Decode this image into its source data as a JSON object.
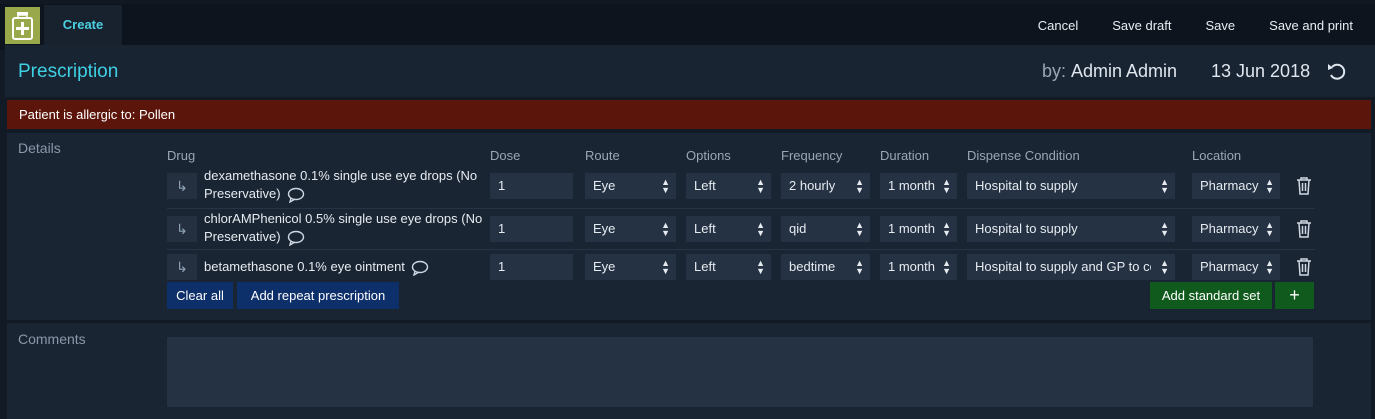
{
  "topbar": {
    "create_tab": "Create",
    "actions": [
      "Cancel",
      "Save draft",
      "Save",
      "Save and print"
    ]
  },
  "header": {
    "title": "Prescription",
    "by_label": "by:",
    "by_name": "Admin Admin",
    "date": "13 Jun 2018"
  },
  "alert": {
    "text": "Patient is allergic to: Pollen"
  },
  "details": {
    "label": "Details",
    "columns": {
      "drug": "Drug",
      "dose": "Dose",
      "route": "Route",
      "options": "Options",
      "frequency": "Frequency",
      "duration": "Duration",
      "dispense": "Dispense Condition",
      "location": "Location"
    },
    "rows": [
      {
        "drug_line1": "dexamethasone 0.1% single use eye drops (No",
        "drug_line2": "Preservative)",
        "dose": "1",
        "route": "Eye",
        "option": "Left",
        "frequency": "2 hourly",
        "duration": "1 month",
        "dispense": "Hospital to supply",
        "location": "Pharmacy"
      },
      {
        "drug_line1": "chlorAMPhenicol 0.5% single use eye drops (No",
        "drug_line2": "Preservative)",
        "dose": "1",
        "route": "Eye",
        "option": "Left",
        "frequency": "qid",
        "duration": "1 month",
        "dispense": "Hospital to supply",
        "location": "Pharmacy"
      },
      {
        "drug_line1": "betamethasone 0.1% eye ointment",
        "drug_line2": "",
        "dose": "1",
        "route": "Eye",
        "option": "Left",
        "frequency": "bedtime",
        "duration": "1 month",
        "dispense": "Hospital to supply and GP to co",
        "location": "Pharmacy"
      }
    ],
    "buttons": {
      "clear_all": "Clear all",
      "add_repeat": "Add repeat prescription",
      "add_standard_set": "Add standard set",
      "add_plus": "+"
    }
  },
  "comments": {
    "label": "Comments",
    "value": ""
  },
  "icons": {
    "logo": "medicine-bottle-icon",
    "undo": "undo-icon",
    "repeat": "repeat-arrow-icon",
    "comment": "comment-icon",
    "trash": "trash-icon"
  },
  "colors": {
    "accent": "#3ed0e3",
    "alert_bg": "#5b150a",
    "primary_button": "#0d2f6a",
    "success_button": "#0f5a1c",
    "logo_bg": "#98a84b"
  }
}
